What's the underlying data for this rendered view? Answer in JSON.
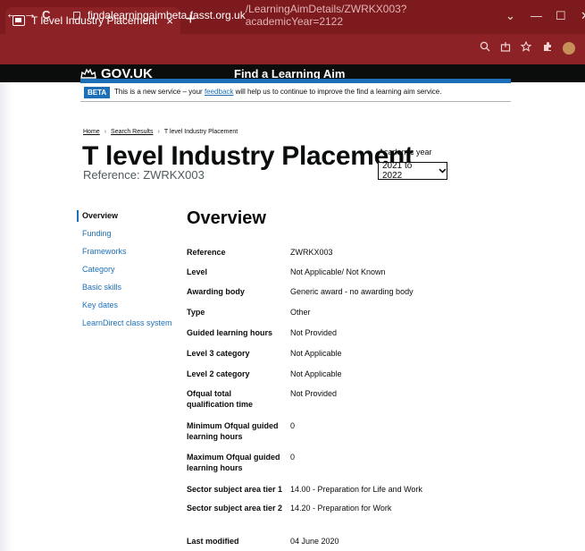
{
  "browser": {
    "tab_title": "T level Industry Placement",
    "tab_close": "×",
    "new_tab": "+",
    "url_host": "findalearningaimbeta.fasst.org.uk",
    "url_path": "/LearningAimDetails/ZWRKX003?academicYear=2122",
    "back": "←",
    "forward": "→",
    "reload": "C",
    "minimize": "—",
    "maximize": "☐",
    "close": "✕",
    "tab_list": "⌄"
  },
  "header": {
    "logo_text": "GOV.UK",
    "service_name": "Find a Learning Aim",
    "brand_color": "#1d70b8"
  },
  "beta_banner": {
    "tag": "BETA",
    "text_before": "This is a new service – your ",
    "link": "feedback",
    "text_after": " will help us to continue to improve the find a learning aim service."
  },
  "breadcrumbs": [
    "Home",
    "Search Results",
    "T level Industry Placement"
  ],
  "page": {
    "title": "T level Industry Placement",
    "reference": "Reference: ZWRKX003",
    "academic_year_label": "Academic year",
    "academic_year_value": "2021 to 2022"
  },
  "sidenav": {
    "items": [
      "Overview",
      "Funding",
      "Frameworks",
      "Category",
      "Basic skills",
      "Key dates",
      "LearnDirect class system"
    ]
  },
  "overview": {
    "heading": "Overview",
    "rows": [
      {
        "key": "Reference",
        "value": "ZWRKX003"
      },
      {
        "key": "Level",
        "value": "Not Applicable/ Not Known"
      },
      {
        "key": "Awarding body",
        "value": "Generic award - no awarding body"
      },
      {
        "key": "Type",
        "value": "Other"
      },
      {
        "key": "Guided learning hours",
        "value": "Not Provided"
      },
      {
        "key": "Level 3 category",
        "value": "Not Applicable"
      },
      {
        "key": "Level 2 category",
        "value": "Not Applicable"
      },
      {
        "key": "Ofqual total qualification time",
        "value": "Not Provided"
      },
      {
        "key": "Minimum Ofqual guided learning hours",
        "value": "0"
      },
      {
        "key": "Maximum Ofqual guided learning hours",
        "value": "0"
      },
      {
        "key": "Sector subject area tier 1",
        "value": "14.00 - Preparation for Life and Work"
      },
      {
        "key": "Sector subject area tier 2",
        "value": "14.20 - Preparation for Work"
      },
      {
        "key": "Last modified",
        "value": "04 June 2020"
      }
    ]
  }
}
